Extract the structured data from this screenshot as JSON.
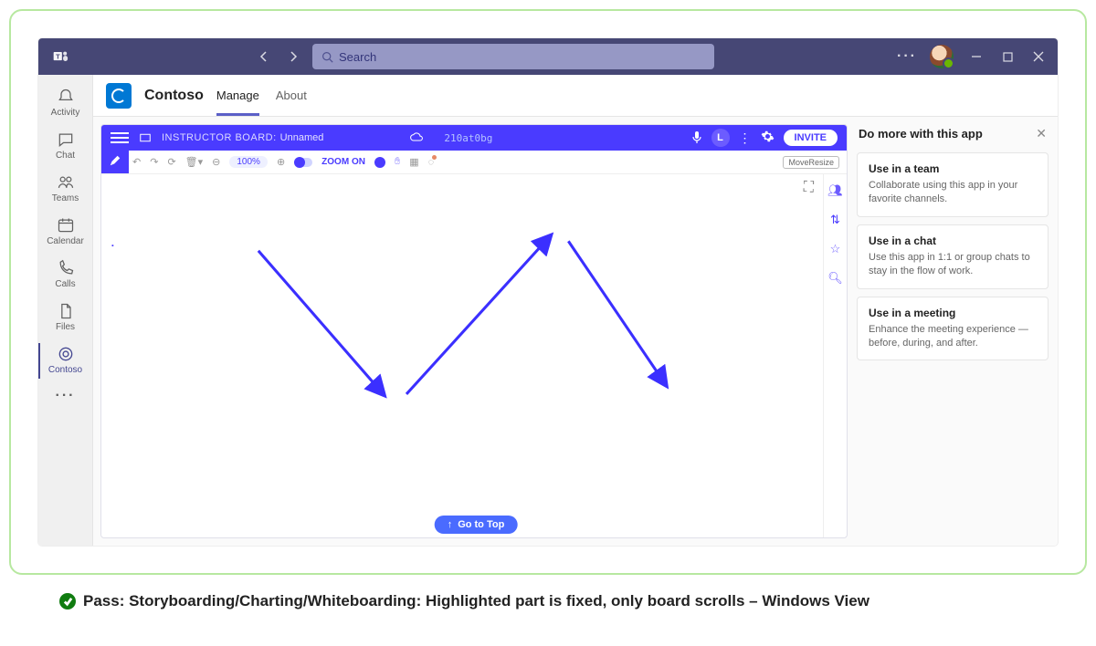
{
  "titlebar": {
    "search_placeholder": "Search"
  },
  "rail": {
    "items": [
      {
        "label": "Activity"
      },
      {
        "label": "Chat"
      },
      {
        "label": "Teams"
      },
      {
        "label": "Calendar"
      },
      {
        "label": "Calls"
      },
      {
        "label": "Files"
      },
      {
        "label": "Contoso"
      }
    ]
  },
  "app_header": {
    "name": "Contoso",
    "tabs": [
      {
        "label": "Manage"
      },
      {
        "label": "About"
      }
    ]
  },
  "whiteboard": {
    "board_tag": "INSTRUCTOR BOARD:",
    "board_name": "Unnamed",
    "board_code": "210at0bg",
    "zoom_percent": "100%",
    "zoom_label": "ZOOM ON",
    "avatar_initial": "L",
    "invite_label": "INVITE",
    "move_resize_label": "MoveResize",
    "goto_top_label": "Go to Top"
  },
  "side_panel": {
    "title": "Do more with this app",
    "cards": [
      {
        "title": "Use in a team",
        "desc": "Collaborate using this app in your favorite channels."
      },
      {
        "title": "Use in a chat",
        "desc": "Use this app in 1:1 or group chats to stay in the flow of work."
      },
      {
        "title": "Use in a meeting",
        "desc": "Enhance the meeting experience — before, during, and after."
      }
    ]
  },
  "caption": {
    "text": "Pass: Storyboarding/Charting/Whiteboarding: Highlighted part is fixed, only board scrolls – Windows View"
  }
}
